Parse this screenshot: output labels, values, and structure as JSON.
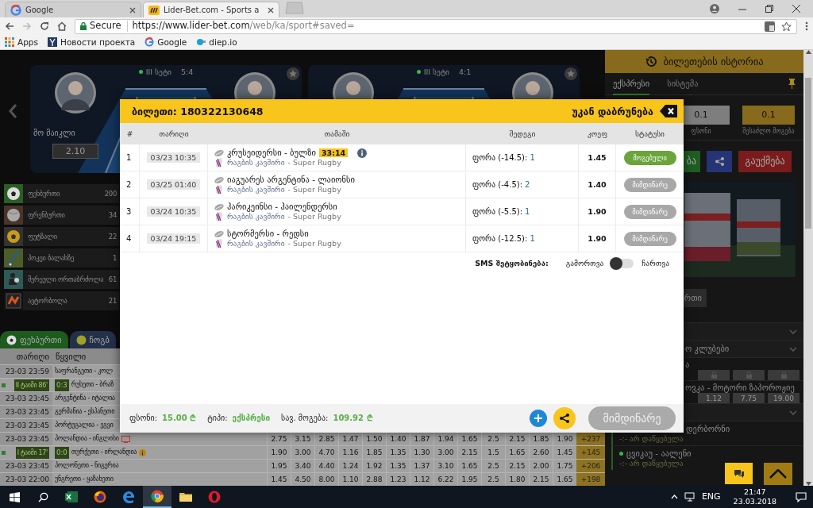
{
  "browser": {
    "tabs": [
      {
        "title": "Google",
        "kind": "google",
        "selected": false
      },
      {
        "title": "Lider-Bet.com - Sports a",
        "kind": "liderbet",
        "selected": true
      }
    ],
    "security": "Secure",
    "url_host": "https://www.lider-bet.com",
    "url_path": "/web/ka/sport#saved=",
    "bookmarks": [
      {
        "kind": "apps",
        "label": "Apps"
      },
      {
        "kind": "yandex",
        "label": "Новости проекта"
      },
      {
        "kind": "google",
        "label": "Google"
      },
      {
        "kind": "diep",
        "label": "diep.io"
      }
    ]
  },
  "live_cards": [
    {
      "period": "III სეტი",
      "score": "5:4",
      "player": "მო მაიკლი",
      "odds": "2.10"
    },
    {
      "period": "III სეტი",
      "score": "4:1"
    }
  ],
  "sports": [
    {
      "kind": "football",
      "name": "ფეხბურთი",
      "count": "200"
    },
    {
      "kind": "volleyball",
      "name": "ფრენბურთი",
      "count": "34"
    },
    {
      "kind": "futsal",
      "name": "ფუტზალი",
      "count": "22"
    },
    {
      "kind": "hockey",
      "name": "ჰოკეი ბალახზე",
      "count": "1"
    },
    {
      "kind": "mma",
      "name": "შერეული ორთაბრძოლა",
      "count": "61"
    },
    {
      "kind": "racing",
      "name": "ავტორბოლა",
      "count": "21"
    }
  ],
  "sport_tabs": [
    {
      "kind": "football",
      "label": "ფეხბურთი",
      "selected": true
    },
    {
      "kind": "tennis",
      "label": "ჩოგბ",
      "selected": false
    }
  ],
  "matches": {
    "columns": [
      "თარიღი",
      "წყვილი"
    ],
    "rows": [
      {
        "kind": "scheduled",
        "date": "23-03 23:59",
        "pair": "საფრანგეთი - კოლ"
      },
      {
        "kind": "live",
        "period": "II ტაიმი 86'",
        "score": "0:3",
        "pair": "რუსეთი - ბრაზ"
      },
      {
        "kind": "scheduled",
        "date": "23-03 23:45",
        "pair": "არგენტინა - იტალია"
      },
      {
        "kind": "scheduled",
        "date": "23-03 23:45",
        "pair": "გერმანია - ესპანეთი"
      },
      {
        "kind": "scheduled",
        "date": "23-03 23:45",
        "pair": "პორტუგალია - ეგვი"
      },
      {
        "kind": "scheduled",
        "date": "23-03 23:45",
        "pair": "პოლანდია - ინგლისი",
        "tv": true,
        "odds": [
          "2.75",
          "3.15",
          "2.85",
          "1.47",
          "1.50",
          "1.40",
          "1.87",
          "1.94",
          "1.65",
          "2.5",
          "2.15",
          "1.85",
          "1.90"
        ],
        "markets": "+237"
      },
      {
        "kind": "live",
        "period": "I ტაიმი 17'",
        "score": "0:0",
        "pair": "თურქეთი - ირლანდია",
        "info": true,
        "odds": [
          "1.90",
          "3.00",
          "4.70",
          "1.16",
          "1.85",
          "1.35",
          "1.30",
          "3.00",
          "2.15",
          "1.5",
          "1.65",
          "2.60",
          "1.45"
        ],
        "markets": "+145"
      },
      {
        "kind": "scheduled",
        "date": "23-03 23:45",
        "pair": "პოლონეთი - ნიგერია",
        "odds": [
          "1.95",
          "3.40",
          "4.40",
          "1.24",
          "1.92",
          "1.35",
          "1.37",
          "3.10",
          "1.65",
          "2.5",
          "2.15",
          "2.00",
          "1.75"
        ],
        "markets": "+206"
      },
      {
        "kind": "scheduled",
        "date": "23-03 22:00",
        "pair": "უნგრეთი - ყაზახეთი",
        "odds": [
          "1.45",
          "4.50",
          "8.00",
          "1.10",
          "2.88",
          "1.23",
          "1.12",
          "6.22",
          "1.95",
          "2.5",
          "1.80",
          "2.15",
          "1.65"
        ],
        "markets": "+198"
      }
    ]
  },
  "bet_panel": {
    "title": "ბილეთების ისტორია",
    "tabs": [
      {
        "label": "ექსპრესი",
        "selected": true
      },
      {
        "label": "სისტემა",
        "selected": false
      }
    ],
    "stake": {
      "value": "0.1",
      "label": "ფსონი"
    },
    "possible_win": {
      "value": "0.1",
      "label": "შესაძლო მოგება"
    },
    "buttons": [
      {
        "kind": "place",
        "label": "ბა"
      },
      {
        "kind": "share"
      },
      {
        "kind": "cancel",
        "label": "გაუქმება"
      }
    ],
    "filter_tab": "რთი",
    "events": [
      {
        "kind": "group"
      },
      {
        "kind": "group",
        "label": "ო კლუბები"
      },
      {
        "kind": "match",
        "label": "ა",
        "locked": true
      },
      {
        "kind": "match",
        "label": "ოვკა - მოტორი ზაპოროჟიე",
        "odds": [
          "1.12",
          "7.75",
          "19.00"
        ]
      },
      {
        "kind": "group"
      },
      {
        "kind": "upcoming",
        "label": "დერბორნი",
        "status": "-:- არ დაწყებულა",
        "live": false
      },
      {
        "kind": "upcoming",
        "label": "ცვიკაუ - აალენი",
        "status": "-:- არ დაწყებულა",
        "live": true
      }
    ]
  },
  "ticket": {
    "title": "ბილეთი: 180322130648",
    "back": "უკან დაბრუნება",
    "columns": [
      "#",
      "თარიღი",
      "თამაში",
      "შედეგი",
      "კოეფ",
      "სტატუსი"
    ],
    "rows": [
      {
        "index": "1",
        "date": "03/23 10:35",
        "game": "კრუსეიდერსი - ბულზი",
        "live_time": "33:14",
        "info": true,
        "league": "რაგბის კავშირი",
        "tournament": "- Super Rugby",
        "market": "ფორა (-14.5):",
        "pick": "1",
        "odds": "1.45",
        "status": {
          "kind": "won",
          "label": "მოგებული"
        }
      },
      {
        "index": "2",
        "date": "03/25 01:40",
        "game": "იაგუარეს არგენტინა - ლაიონსი",
        "league": "რაგბის კავშირი",
        "tournament": "- Super Rugby",
        "market": "ფორა (-4.5):",
        "pick": "2",
        "odds": "1.40",
        "status": {
          "kind": "pending",
          "label": "მიმდინარე"
        }
      },
      {
        "index": "3",
        "date": "03/24 10:35",
        "game": "ჰარიკეინსი - ჰაილენდერსი",
        "league": "რაგბის კავშირი",
        "tournament": "- Super Rugby",
        "market": "ფორა (-5.5):",
        "pick": "1",
        "odds": "1.90",
        "status": {
          "kind": "pending",
          "label": "მიმდინარე"
        }
      },
      {
        "index": "4",
        "date": "03/24 19:15",
        "game": "სტორმერსი - რედსი",
        "league": "რაგბის კავშირი",
        "tournament": "- Super Rugby",
        "market": "ფორა (-12.5):",
        "pick": "1",
        "odds": "1.90",
        "status": {
          "kind": "pending",
          "label": "მიმდინარე"
        }
      }
    ],
    "sms": {
      "label": "SMS შეტყობინება:",
      "off_label": "გამორთვა",
      "on_label": "ჩართვა",
      "on": false
    },
    "summary": [
      {
        "label": "ფსონი:",
        "value": "15.00 ₾"
      },
      {
        "label": "ტიპი:",
        "value": "ექსპრესი"
      },
      {
        "label": "სავ. მოგება:",
        "value": "109.92 ₾"
      }
    ],
    "status_button": "მიმდინარე"
  },
  "taskbar": {
    "apps": [
      {
        "kind": "excel",
        "selected": false
      },
      {
        "kind": "firefox",
        "selected": false
      },
      {
        "kind": "edge",
        "selected": false
      },
      {
        "kind": "chrome",
        "selected": true
      },
      {
        "kind": "folder",
        "selected": false
      },
      {
        "kind": "opera",
        "selected": false
      }
    ],
    "language": "ENG",
    "time": "21:47",
    "date": "23.03.2018"
  }
}
